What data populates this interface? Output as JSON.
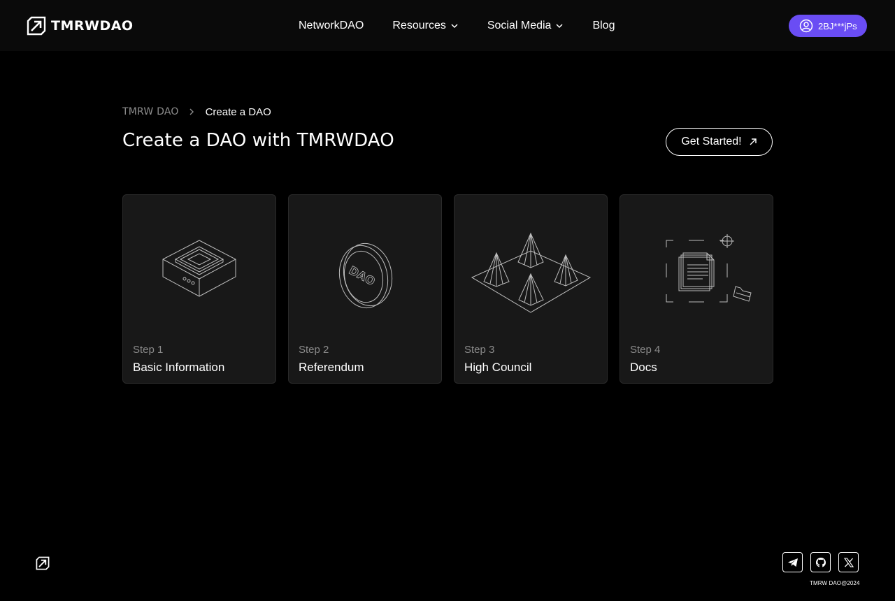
{
  "header": {
    "brand": "TMRWDAO",
    "logo_icon": "arrow-up-right-logo-icon",
    "nav": [
      {
        "label": "NetworkDAO",
        "dropdown": false
      },
      {
        "label": "Resources",
        "dropdown": true
      },
      {
        "label": "Social Media",
        "dropdown": true
      },
      {
        "label": "Blog",
        "dropdown": false
      }
    ],
    "wallet": {
      "label": "2BJ***jPs",
      "icon": "user-avatar-icon"
    }
  },
  "breadcrumb": {
    "root": "TMRW DAO",
    "current": "Create a DAO"
  },
  "page": {
    "title": "Create a DAO with TMRWDAO",
    "cta_label": "Get Started!"
  },
  "steps": [
    {
      "step": "Step 1",
      "title": "Basic Information",
      "icon": "device-box-illustration"
    },
    {
      "step": "Step 2",
      "title": "Referendum",
      "icon": "dao-coin-illustration",
      "coin_text": "DAO"
    },
    {
      "step": "Step 3",
      "title": "High Council",
      "icon": "pyramids-platform-illustration"
    },
    {
      "step": "Step 4",
      "title": "Docs",
      "icon": "documents-illustration"
    }
  ],
  "footer": {
    "copyright": "TMRW DAO@2024",
    "socials": [
      "telegram-icon",
      "github-icon",
      "x-icon"
    ]
  },
  "colors": {
    "background": "#000000",
    "header": "#0a0a0a",
    "card": "#181818",
    "wallet_accent": "#6a4df4",
    "muted_text": "#8a8a8a"
  }
}
